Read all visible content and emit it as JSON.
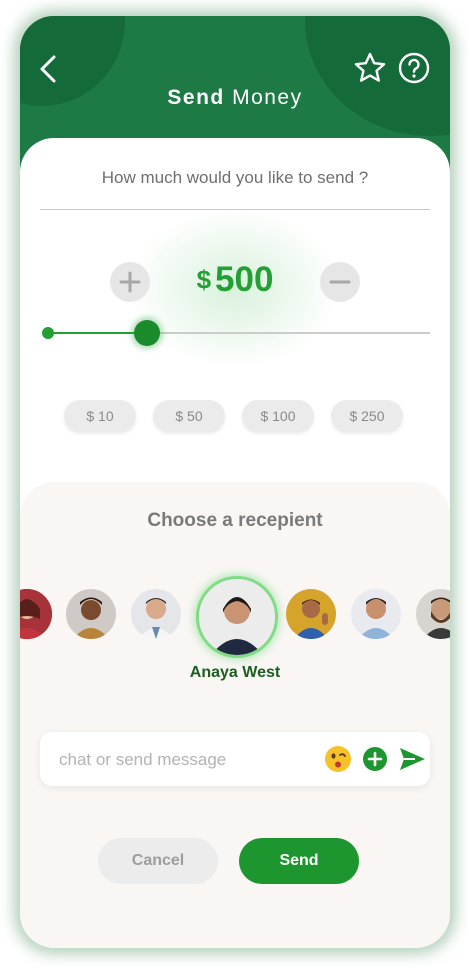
{
  "header": {
    "title_bold": "Send",
    "title_rest": "Money",
    "back_icon": "chevron-left-icon",
    "favorite_icon": "star-icon",
    "help_icon": "help-circle-icon"
  },
  "amount_section": {
    "question": "How much would you like to send ?",
    "currency": "$",
    "amount": "500",
    "slider_level": 0.26,
    "increase_icon": "plus-icon",
    "decrease_icon": "minus-icon",
    "presets": [
      "$ 10",
      "$ 50",
      "$ 100",
      "$ 250"
    ]
  },
  "recipient_section": {
    "title": "Choose a recepient",
    "selected_name": "Anaya West",
    "avatars_count": 8
  },
  "message": {
    "placeholder": "chat or send message",
    "emoji_icon": "emoji-icon",
    "attach_icon": "add-circle-icon",
    "send_icon": "send-arrow-icon"
  },
  "actions": {
    "cancel_label": "Cancel",
    "send_label": "Send"
  },
  "colors": {
    "brand_green": "#1d7a45",
    "accent_green": "#23a033",
    "selected_ring": "#7fdc85"
  }
}
